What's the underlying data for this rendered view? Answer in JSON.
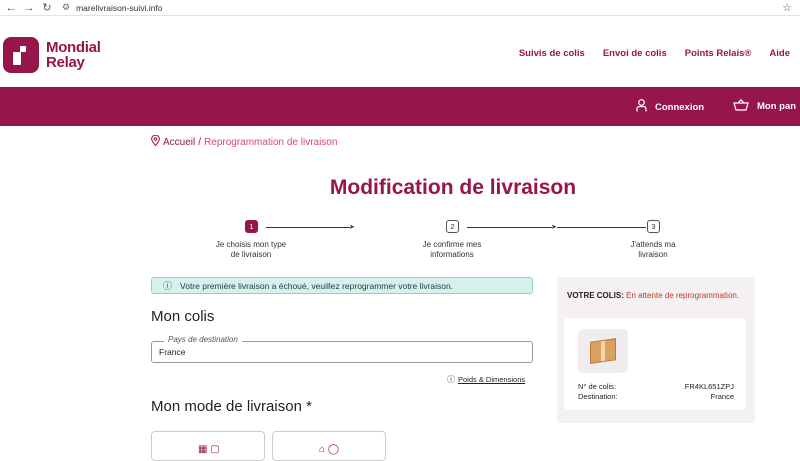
{
  "browser": {
    "url": "marelivraison-suivi.info"
  },
  "header": {
    "logo_line1": "Mondial",
    "logo_line2": "Relay",
    "nav": [
      "Suivis de colis",
      "Envoi de colis",
      "Points Relais®",
      "Aide"
    ]
  },
  "topbar": {
    "login": "Connexion",
    "cart": "Mon pan"
  },
  "breadcrumb": {
    "home": "Accueil",
    "separator": "/",
    "current": "Reprogrammation de livraison"
  },
  "page_title": "Modification de livraison",
  "steps": [
    {
      "number": "1",
      "line1": "Je choisis mon type",
      "line2": "de livraison",
      "active": true
    },
    {
      "number": "2",
      "line1": "Je confirme mes",
      "line2": "informations",
      "active": false
    },
    {
      "number": "3",
      "line1": "J'attends ma",
      "line2": "livraison",
      "active": false
    }
  ],
  "alert": {
    "text": "Votre première livraison a échoué, veuillez reprogrammer votre livraison."
  },
  "colis_section": {
    "heading": "Mon colis",
    "country_label": "Pays de destination",
    "country_value": "France",
    "poids_link": "Poids & Dimensions"
  },
  "mode_section": {
    "heading": "Mon mode de livraison *"
  },
  "panel": {
    "title": "VOTRE COLIS:",
    "status": "En attente de reprogrammation.",
    "parcel_label": "N° de colis:",
    "parcel_value": "FR4KL651ZPJ",
    "destination_label": "Destination:",
    "destination_value": "France"
  },
  "colors": {
    "brand": "#96154a",
    "alert_bg": "#d7f0ee",
    "status_red": "#c0392b"
  }
}
